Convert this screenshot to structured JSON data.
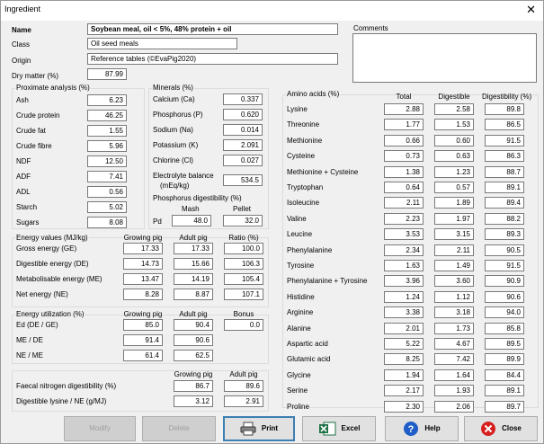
{
  "window": {
    "title": "Ingredient",
    "close_glyph": "✕"
  },
  "ident": {
    "name_label": "Name",
    "name": "Soybean meal, oil < 5%, 48% protein + oil",
    "class_label": "Class",
    "class": "Oil seed meals",
    "origin_label": "Origin",
    "origin": "Reference tables (©EvaPig2020)",
    "dm_label": "Dry matter (%)",
    "dm": "87.99",
    "comments_label": "Comments"
  },
  "proximate": {
    "title": "Proximate analysis (%)",
    "rows": [
      {
        "label": "Ash",
        "value": "6.23"
      },
      {
        "label": "Crude protein",
        "value": "46.25"
      },
      {
        "label": "Crude fat",
        "value": "1.55"
      },
      {
        "label": "Crude fibre",
        "value": "5.96"
      },
      {
        "label": "NDF",
        "value": "12.50"
      },
      {
        "label": "ADF",
        "value": "7.41"
      },
      {
        "label": "ADL",
        "value": "0.56"
      },
      {
        "label": "Starch",
        "value": "5.02"
      },
      {
        "label": "Sugars",
        "value": "8.08"
      }
    ]
  },
  "minerals": {
    "title": "Minerals (%)",
    "rows": [
      {
        "label": "Calcium (Ca)",
        "value": "0.337"
      },
      {
        "label": "Phosphorus (P)",
        "value": "0.620"
      },
      {
        "label": "Sodium (Na)",
        "value": "0.014"
      },
      {
        "label": "Potassium (K)",
        "value": "2.091"
      },
      {
        "label": "Chlorine (Cl)",
        "value": "0.027"
      }
    ],
    "eb_label1": "Electrolyte balance",
    "eb_label2": "(mEq/kg)",
    "eb": "534.5",
    "pd_title": "Phosphorus digestibility (%)",
    "mash_label": "Mash",
    "pellet_label": "Pellet",
    "pd_label": "Pd",
    "mash": "48.0",
    "pellet": "32.0"
  },
  "energy": {
    "title": "Energy values (MJ/kg)",
    "cols": [
      "Growing pig",
      "Adult pig",
      "Ratio (%)"
    ],
    "rows": [
      {
        "label": "Gross energy (GE)",
        "v": [
          "17.33",
          "17.33",
          "100.0"
        ]
      },
      {
        "label": "Digestible energy (DE)",
        "v": [
          "14.73",
          "15.66",
          "106.3"
        ]
      },
      {
        "label": "Metabolisable energy (ME)",
        "v": [
          "13.47",
          "14.19",
          "105.4"
        ]
      },
      {
        "label": "Net energy (NE)",
        "v": [
          "8.28",
          "8.87",
          "107.1"
        ]
      }
    ]
  },
  "util": {
    "title": "Energy utilization (%)",
    "cols": [
      "Growing pig",
      "Adult pig",
      "Bonus"
    ],
    "rows": [
      {
        "label": "Ed (DE / GE)",
        "v": [
          "85.0",
          "90.4",
          "0.0"
        ]
      },
      {
        "label": "ME / DE",
        "v": [
          "91.4",
          "90.6",
          ""
        ]
      },
      {
        "label": "NE / ME",
        "v": [
          "61.4",
          "62.5",
          ""
        ]
      }
    ]
  },
  "faecal": {
    "cols": [
      "Growing pig",
      "Adult pig"
    ],
    "rows": [
      {
        "label": "Faecal nitrogen digestibility (%)",
        "v": [
          "86.7",
          "89.6"
        ]
      },
      {
        "label": "Digestible lysine / NE (g/MJ)",
        "v": [
          "3.12",
          "2.91"
        ]
      }
    ]
  },
  "amino": {
    "title": "Amino acids (%)",
    "cols": [
      "Total",
      "Digestible",
      "Digestibility (%)"
    ],
    "rows": [
      {
        "label": "Lysine",
        "v": [
          "2.88",
          "2.58",
          "89.8"
        ]
      },
      {
        "label": "Threonine",
        "v": [
          "1.77",
          "1.53",
          "86.5"
        ]
      },
      {
        "label": "Methionine",
        "v": [
          "0.66",
          "0.60",
          "91.5"
        ]
      },
      {
        "label": "Cysteine",
        "v": [
          "0.73",
          "0.63",
          "86.3"
        ]
      },
      {
        "label": "Methionine + Cysteine",
        "v": [
          "1.38",
          "1.23",
          "88.7"
        ]
      },
      {
        "label": "Tryptophan",
        "v": [
          "0.64",
          "0.57",
          "89.1"
        ]
      },
      {
        "label": "Isoleucine",
        "v": [
          "2.11",
          "1.89",
          "89.4"
        ]
      },
      {
        "label": "Valine",
        "v": [
          "2.23",
          "1.97",
          "88.2"
        ]
      },
      {
        "label": "Leucine",
        "v": [
          "3.53",
          "3.15",
          "89.3"
        ]
      },
      {
        "label": "Phenylalanine",
        "v": [
          "2.34",
          "2.11",
          "90.5"
        ]
      },
      {
        "label": "Tyrosine",
        "v": [
          "1.63",
          "1.49",
          "91.5"
        ]
      },
      {
        "label": "Phenylalanine + Tyrosine",
        "v": [
          "3.96",
          "3.60",
          "90.9"
        ]
      },
      {
        "label": "Histidine",
        "v": [
          "1.24",
          "1.12",
          "90.6"
        ]
      },
      {
        "label": "Arginine",
        "v": [
          "3.38",
          "3.18",
          "94.0"
        ]
      },
      {
        "label": "Alanine",
        "v": [
          "2.01",
          "1.73",
          "85.8"
        ]
      },
      {
        "label": "Aspartic acid",
        "v": [
          "5.22",
          "4.67",
          "89.5"
        ]
      },
      {
        "label": "Glutamic acid",
        "v": [
          "8.25",
          "7.42",
          "89.9"
        ]
      },
      {
        "label": "Glycine",
        "v": [
          "1.94",
          "1.64",
          "84.4"
        ]
      },
      {
        "label": "Serine",
        "v": [
          "2.17",
          "1.93",
          "89.1"
        ]
      },
      {
        "label": "Proline",
        "v": [
          "2.30",
          "2.06",
          "89.7"
        ]
      }
    ]
  },
  "buttons": {
    "modify": "Modify",
    "delete": "Delete",
    "print": "Print",
    "excel": "Excel",
    "help": "Help",
    "close": "Close"
  }
}
